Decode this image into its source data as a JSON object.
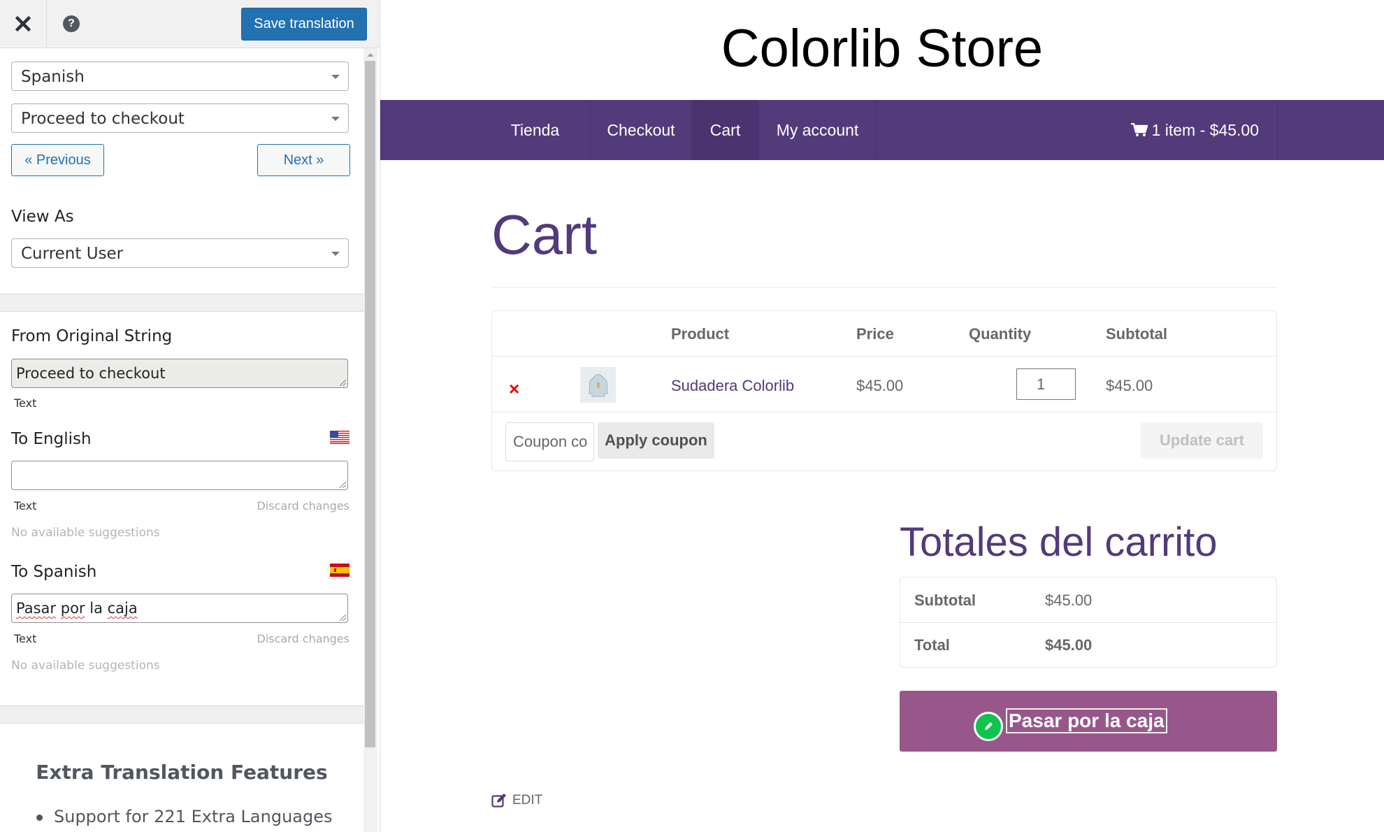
{
  "sidebar": {
    "header": {
      "close_icon": "close-icon",
      "help_icon": "help-icon",
      "help_glyph": "?",
      "save_label": "Save translation"
    },
    "language_select": {
      "value": "Spanish"
    },
    "string_select": {
      "value": "Proceed to checkout"
    },
    "previous_label": "« Previous",
    "next_label": "Next »",
    "view_as_label": "View As",
    "view_as_select": {
      "value": "Current User"
    },
    "original": {
      "label": "From Original String",
      "value": "Proceed to checkout",
      "type": "Text"
    },
    "to_english": {
      "label": "To English",
      "flag": "us-flag",
      "value": "",
      "type": "Text",
      "discard": "Discard changes",
      "suggestions": "No available suggestions"
    },
    "to_spanish": {
      "label": "To Spanish",
      "flag": "es-flag",
      "words": [
        "Pasar",
        "por",
        "la",
        "caja"
      ],
      "value": "Pasar por la caja",
      "type": "Text",
      "discard": "Discard changes",
      "suggestions": "No available suggestions"
    },
    "extra": {
      "title": "Extra Translation Features",
      "items": [
        "Support for 221 Extra Languages"
      ]
    }
  },
  "store": {
    "title": "Colorlib Store",
    "nav": [
      {
        "label": "Tienda",
        "active": false
      },
      {
        "label": "Checkout",
        "active": false
      },
      {
        "label": "Cart",
        "active": true
      },
      {
        "label": "My account",
        "active": false
      }
    ],
    "cart_summary": "1 item - $45.00",
    "colors": {
      "brand": "#533a7b",
      "checkout": "#98578a",
      "remove": "#ee0000",
      "save": "#2271b1",
      "edit_badge": "#0ec44d"
    }
  },
  "cart": {
    "heading": "Cart",
    "columns": [
      "Product",
      "Price",
      "Quantity",
      "Subtotal"
    ],
    "items": [
      {
        "remove": "×",
        "product": "Sudadera Colorlib",
        "price": "$45.00",
        "quantity": "1",
        "subtotal": "$45.00"
      }
    ],
    "coupon_placeholder": "Coupon code",
    "coupon_visible": "Coupon co",
    "apply_label": "Apply coupon",
    "update_label": "Update cart"
  },
  "totals": {
    "heading": "Totales del carrito",
    "rows": [
      {
        "label": "Subtotal",
        "value": "$45.00"
      },
      {
        "label": "Total",
        "value": "$45.00"
      }
    ],
    "checkout_label": "Pasar por la caja"
  },
  "edit_label": "EDIT"
}
